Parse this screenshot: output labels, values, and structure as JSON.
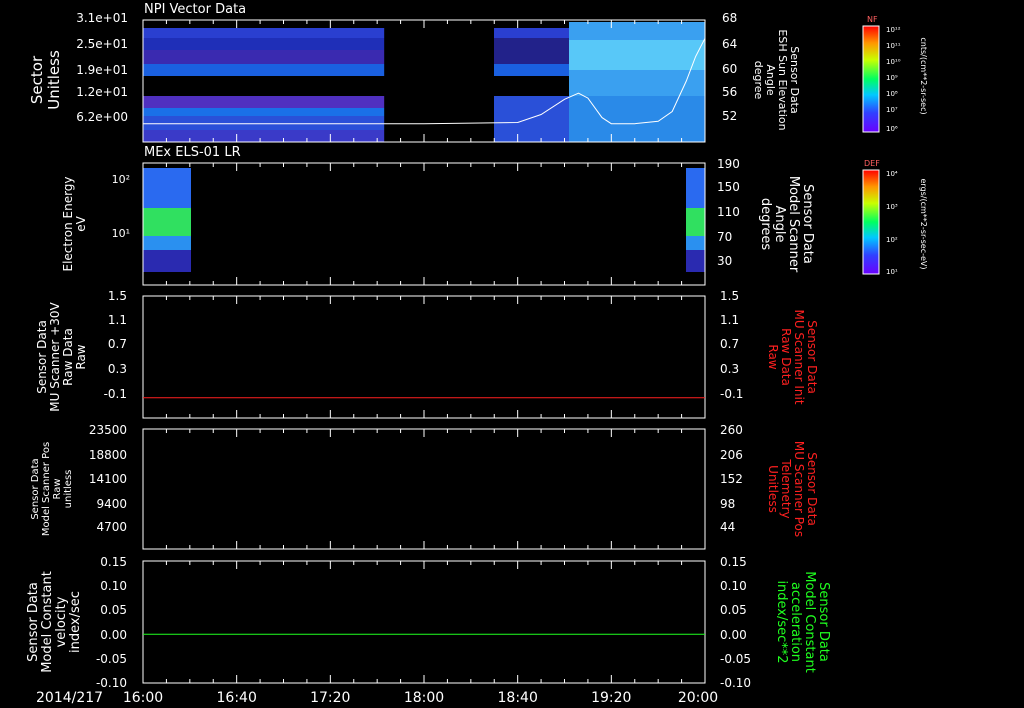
{
  "date_label": "2014/217",
  "time_ticks": [
    "16:00",
    "16:40",
    "17:20",
    "18:00",
    "18:40",
    "19:20",
    "20:00"
  ],
  "time_range_min": [
    0,
    240
  ],
  "panels": {
    "p1": {
      "title": "NPI Vector Data",
      "left_label": [
        "Sector",
        "Unitless"
      ],
      "left_ticks": [
        "3.1e+01",
        "2.5e+01",
        "1.9e+01",
        "1.2e+01",
        "6.2e+00"
      ],
      "right_label": [
        "Sensor Data",
        "ESH Sun Elevation",
        "Angle",
        "degree"
      ],
      "right_ticks": [
        "68",
        "64",
        "60",
        "56",
        "52"
      ],
      "right_color": "#ffffff",
      "colorbar": {
        "title": "NF",
        "units": "cnts/(cm**2-sr-sec)",
        "ticks": [
          "10¹²",
          "10¹¹",
          "10¹⁰",
          "10⁹",
          "10⁸",
          "10⁷",
          "10⁶"
        ]
      }
    },
    "p2": {
      "title": "MEx ELS-01 LR",
      "left_label": [
        "Electron Energy",
        "eV"
      ],
      "left_ticks": [
        "10²",
        "10¹"
      ],
      "right_label": [
        "Sensor Data",
        "Model Scanner",
        "Angle",
        "degrees"
      ],
      "right_ticks": [
        "190",
        "150",
        "110",
        "70",
        "30"
      ],
      "right_color": "#ffffff",
      "colorbar": {
        "title": "DEF",
        "units": "ergs/(cm**2-sr-sec-eV)",
        "ticks": [
          "10⁴",
          "10³",
          "10²",
          "10¹"
        ]
      }
    },
    "p3": {
      "left_label": [
        "Sensor Data",
        "MU Scanner +30V",
        "Raw Data",
        "Raw"
      ],
      "left_ticks": [
        "1.5",
        "1.1",
        "0.7",
        "0.3",
        "-0.1"
      ],
      "right_label": [
        "Sensor Data",
        "MU Scanner Init",
        "Raw Data",
        "Raw"
      ],
      "right_ticks": [
        "1.5",
        "1.1",
        "0.7",
        "0.3",
        "-0.1"
      ],
      "right_color": "#ff2020"
    },
    "p4": {
      "left_label": [
        "Sensor Data",
        "Model Scanner Pos",
        "Raw",
        "unitless"
      ],
      "left_ticks": [
        "23500",
        "18800",
        "14100",
        "9400",
        "4700"
      ],
      "right_label": [
        "Sensor Data",
        "MU Scanner Pos",
        "Telemetry",
        "Unitless"
      ],
      "right_ticks": [
        "260",
        "206",
        "152",
        "98",
        "44"
      ],
      "right_color": "#ff2020"
    },
    "p5": {
      "left_label": [
        "Sensor Data",
        "Model Constant",
        "velocity",
        "index/sec"
      ],
      "left_ticks": [
        "0.15",
        "0.10",
        "0.05",
        "0.00",
        "-0.05",
        "-0.10"
      ],
      "right_label": [
        "Sensor Data",
        "Model Constant",
        "acceleration",
        "index/sec**2"
      ],
      "right_ticks": [
        "0.15",
        "0.10",
        "0.05",
        "0.00",
        "-0.05",
        "-0.10"
      ],
      "right_color": "#20ff20"
    }
  },
  "chart_data": [
    {
      "type": "heatmap",
      "title": "NPI Vector Data",
      "ylabel": "Sector Unitless",
      "y2label": "Sensor Data ESH Sun Elevation Angle degree",
      "ylim": [
        0,
        32
      ],
      "y2lim": [
        48,
        68
      ],
      "x_minutes": [
        0,
        240
      ],
      "data_gap_minutes": [
        103,
        135
      ],
      "series": [
        {
          "name": "ESH Sun Elevation Angle",
          "color": "#ffffff",
          "x": [
            0,
            40,
            80,
            120,
            160,
            170,
            180,
            186,
            190,
            196,
            200,
            210,
            220,
            226,
            232,
            236,
            240
          ],
          "y": [
            51,
            51,
            51,
            51,
            51.2,
            52.5,
            55,
            56,
            55.2,
            52,
            51,
            51,
            51.4,
            53,
            58,
            62,
            65
          ]
        }
      ]
    },
    {
      "type": "heatmap",
      "title": "MEx ELS-01 LR",
      "ylabel": "Electron Energy eV",
      "y2label": "Sensor Data Model Scanner Angle degrees",
      "y2lim": [
        10,
        190
      ],
      "data_intervals_minutes": [
        [
          0,
          20
        ],
        [
          231,
          240
        ]
      ],
      "series": [
        {
          "name": "Model Scanner Angle",
          "color": "#ffffff",
          "x": [
            0,
            240
          ],
          "y": [
            10,
            10
          ]
        }
      ]
    },
    {
      "type": "line",
      "ylim": [
        -0.3,
        1.5
      ],
      "y2lim": [
        -0.3,
        1.5
      ],
      "series": [
        {
          "name": "MU Scanner Init Raw",
          "color": "#ff2020",
          "x": [
            0,
            240
          ],
          "y": [
            0.0,
            0.0
          ]
        }
      ]
    },
    {
      "type": "line",
      "ylim": [
        0,
        23500
      ],
      "y2lim": [
        0,
        260
      ],
      "series": [
        {
          "name": "MU Scanner Pos Telemetry",
          "color": "#ff2020",
          "x": [
            0,
            240
          ],
          "y": [
            8600,
            8600
          ]
        }
      ]
    },
    {
      "type": "line",
      "ylim": [
        -0.1,
        0.15
      ],
      "y2lim": [
        -0.1,
        0.15
      ],
      "series": [
        {
          "name": "Model Constant acceleration",
          "color": "#20ff20",
          "x": [
            0,
            240
          ],
          "y": [
            0.0,
            0.0
          ]
        }
      ]
    }
  ]
}
